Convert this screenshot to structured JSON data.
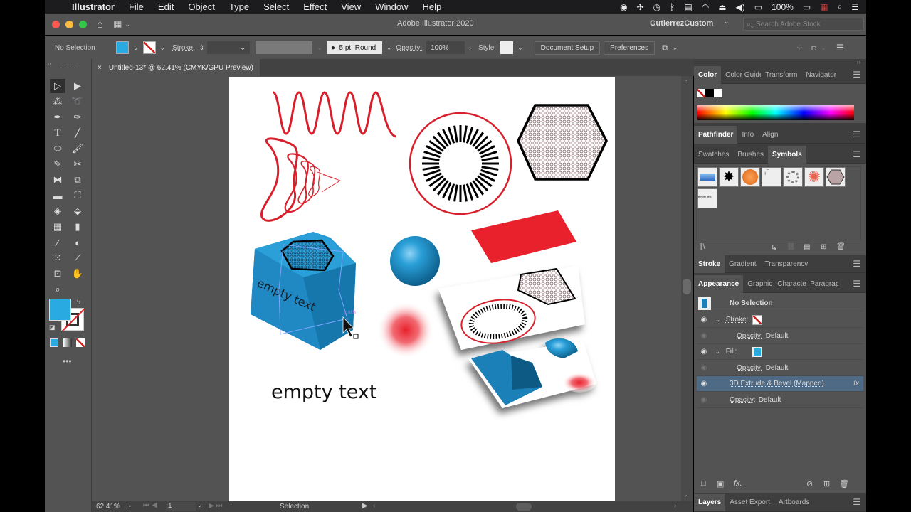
{
  "menubar": {
    "apple": "",
    "app": "Illustrator",
    "items": [
      "File",
      "Edit",
      "Object",
      "Type",
      "Select",
      "Effect",
      "View",
      "Window",
      "Help"
    ],
    "battery": "100%"
  },
  "titlebar": {
    "title": "Adobe Illustrator 2020",
    "workspace": "GutierrezCustom",
    "search_placeholder": "Search Adobe Stock"
  },
  "control": {
    "selection": "No Selection",
    "fill_color": "#29abe2",
    "stroke_label": "Stroke:",
    "brush": "5 pt. Round",
    "opacity_label": "Opacity:",
    "opacity": "100%",
    "style_label": "Style:",
    "doc_setup": "Document Setup",
    "preferences": "Preferences"
  },
  "document": {
    "tab": "Untitled-13* @ 62.41% (CMYK/GPU Preview)",
    "close": "×"
  },
  "canvas": {
    "cube_text": "empty text",
    "path_label": "path",
    "big_text": "empty text",
    "accent_red": "#e8212d",
    "accent_blue": "#1e90c8"
  },
  "statusbar": {
    "zoom": "62.41%",
    "artboard": "1",
    "tool": "Selection"
  },
  "panels": {
    "group1": [
      "Color",
      "Color Guide",
      "Transform",
      "Navigator"
    ],
    "group2": [
      "Pathfinder",
      "Info",
      "Align"
    ],
    "group3": [
      "Swatches",
      "Brushes",
      "Symbols"
    ],
    "symbols": [
      "blue-bar",
      "ink-splat",
      "orange-button",
      "corner-marks",
      "swirl-ring",
      "daisy",
      "hex-pattern",
      "empty-text-symbol"
    ],
    "symbol_text": "empty text",
    "group4": [
      "Stroke",
      "Gradient",
      "Transparency"
    ],
    "group5": [
      "Appearance",
      "Graphic Styles",
      "Character",
      "Paragraph"
    ],
    "appearance": {
      "title": "No Selection",
      "rows": [
        {
          "label": "Stroke:",
          "value": ""
        },
        {
          "label": "Opacity:",
          "value": "Default"
        },
        {
          "label": "Fill:",
          "value": ""
        },
        {
          "label": "Opacity:",
          "value": "Default"
        },
        {
          "label": "3D Extrude & Bevel (Mapped)",
          "value": "fx"
        },
        {
          "label": "Opacity:",
          "value": "Default"
        }
      ]
    },
    "group6": [
      "Layers",
      "Asset Export",
      "Artboards"
    ]
  }
}
